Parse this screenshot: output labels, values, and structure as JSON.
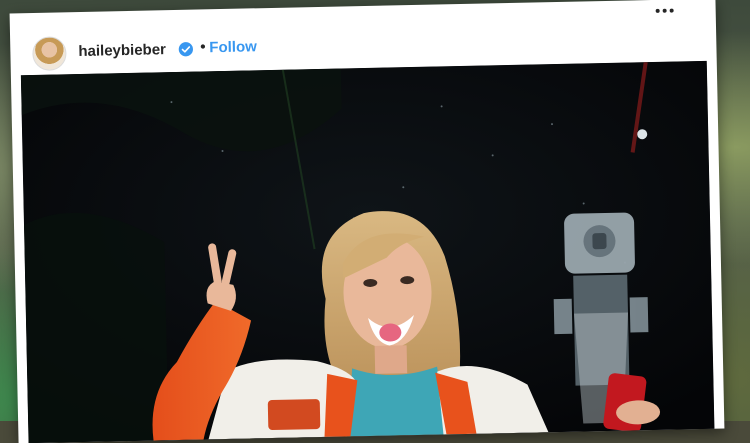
{
  "post": {
    "username": "haileybieber",
    "separator": "•",
    "follow_label": "Follow",
    "verified": true
  },
  "icons": {
    "verified": "verified-badge-icon",
    "more": "more-options-icon",
    "avatar": "profile-avatar"
  },
  "colors": {
    "follow_blue": "#3897f0",
    "verified_blue": "#3897f0",
    "username": "#262626",
    "photo_background": "#07090d",
    "jacket_orange": "#e8521c"
  }
}
